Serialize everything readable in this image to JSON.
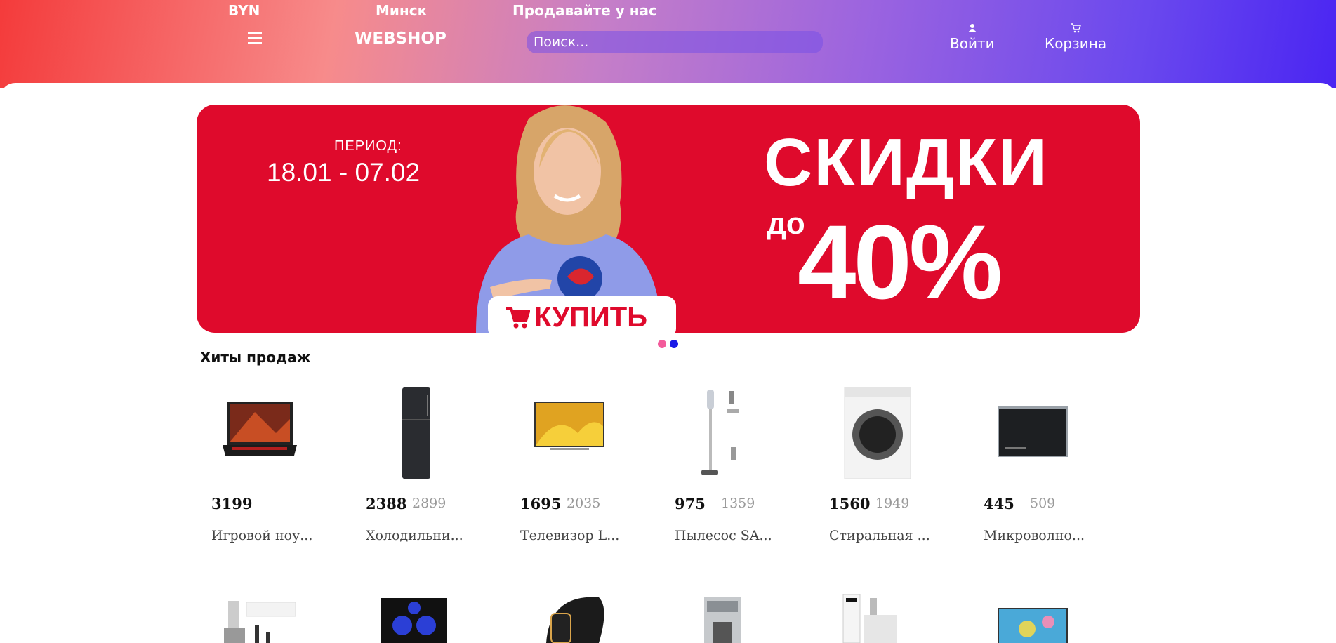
{
  "header": {
    "currency": "BYN",
    "city": "Минск",
    "sell_link": "Продавайте у нас",
    "logo": "WEBSHOP",
    "search_placeholder": "Поиск...",
    "login_label": "Войти",
    "cart_label": "Корзина"
  },
  "banner": {
    "period_label": "ПЕРИОД:",
    "period_dates": "18.01 - 07.02",
    "sale_title": "СКИДКИ",
    "sale_upto": "до",
    "sale_percent": "40%",
    "buy_label": "КУПИТЬ",
    "dots": [
      "active",
      "inactive"
    ]
  },
  "colors": {
    "banner_red": "#df0a2c",
    "dot_active": "#f35b9b",
    "dot_inactive": "#1a1ae6"
  },
  "bestsellers": {
    "title": "Хиты продаж",
    "products": [
      {
        "price": "3199",
        "old_price": "",
        "name": "Игровой ноу...",
        "icon": "laptop-icon"
      },
      {
        "price": "2388",
        "old_price": "2899",
        "name": "Холодильни...",
        "icon": "fridge-icon"
      },
      {
        "price": "1695",
        "old_price": "2035",
        "name": "Телевизор L...",
        "icon": "tv-icon"
      },
      {
        "price": "975",
        "old_price": "1359",
        "name": "Пылесос SA...",
        "icon": "vacuum-icon"
      },
      {
        "price": "1560",
        "old_price": "1949",
        "name": "Стиральная ...",
        "icon": "washer-icon"
      },
      {
        "price": "445",
        "old_price": "509",
        "name": "Микроволно...",
        "icon": "microwave-icon"
      }
    ],
    "next_row_icons": [
      "grinder-icon",
      "speaker-system-icon",
      "fitness-band-icon",
      "coffee-machine-icon",
      "meat-grinder-icon",
      "laptop-icon"
    ]
  }
}
